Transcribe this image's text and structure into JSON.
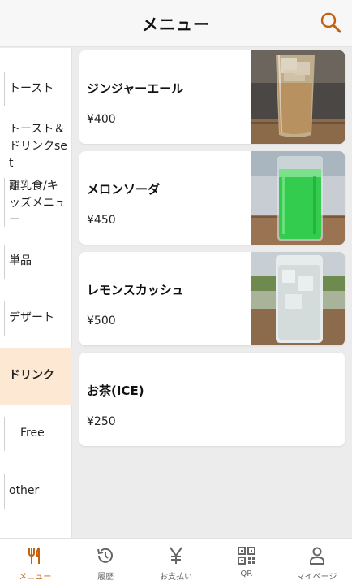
{
  "header": {
    "title": "メニュー",
    "search_icon": "search-icon"
  },
  "sidebar": {
    "items": [
      {
        "label": "トースト"
      },
      {
        "label": "トースト＆ドリンクset"
      },
      {
        "label": "離乳食/キッズメニュー"
      },
      {
        "label": "単品"
      },
      {
        "label": "デザート"
      },
      {
        "label": "ドリンク",
        "active": true
      },
      {
        "label": "Free"
      },
      {
        "label": "other"
      }
    ]
  },
  "menu_items": [
    {
      "name": "ジンジャーエール",
      "price": "¥400",
      "photo": "ginger-ale-glass"
    },
    {
      "name": "メロンソーダ",
      "price": "¥450",
      "photo": "melon-soda-glass"
    },
    {
      "name": "レモンスカッシュ",
      "price": "¥500",
      "photo": "lemon-squash-glass"
    },
    {
      "name": "お茶(ICE)",
      "price": "¥250"
    }
  ],
  "bottom_nav": [
    {
      "label": "メニュー",
      "icon": "fork-knife-icon",
      "active": true
    },
    {
      "label": "履歴",
      "icon": "history-icon"
    },
    {
      "label": "お支払い",
      "icon": "yen-icon"
    },
    {
      "label": "QR",
      "icon": "qr-code-icon"
    },
    {
      "label": "マイページ",
      "icon": "person-icon"
    }
  ],
  "colors": {
    "accent": "#c2620f",
    "active_bg": "#fde8d3",
    "background": "#ececec"
  }
}
